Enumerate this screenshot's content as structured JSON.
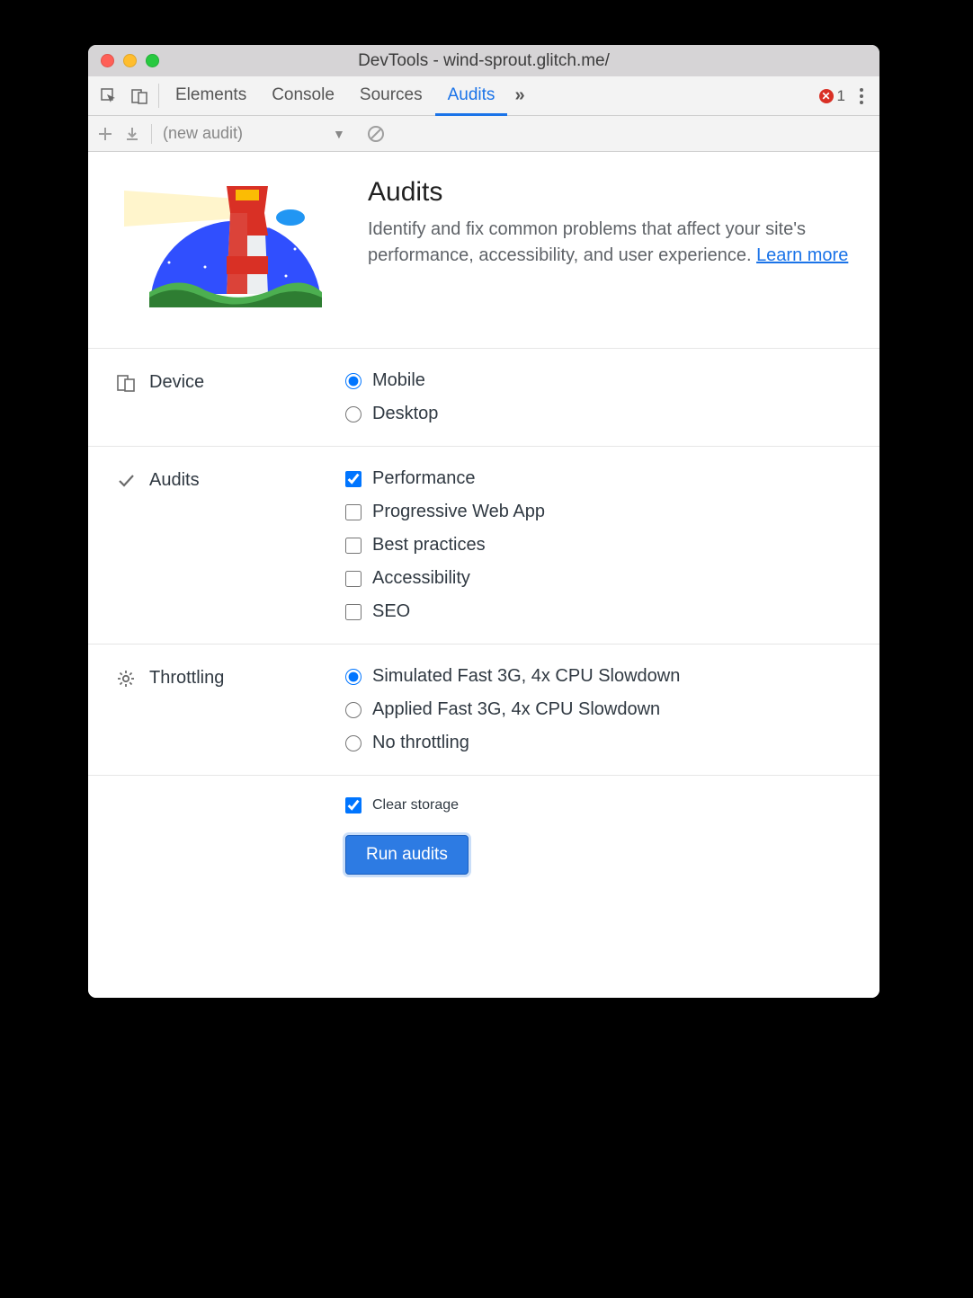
{
  "window": {
    "title": "DevTools - wind-sprout.glitch.me/"
  },
  "tabs": {
    "items": [
      "Elements",
      "Console",
      "Sources",
      "Audits"
    ],
    "active_index": 3,
    "error_count": "1"
  },
  "toolbar": {
    "select_label": "(new audit)"
  },
  "intro": {
    "heading": "Audits",
    "body_prefix": "Identify and fix common problems that affect your site's performance, accessibility, and user experience. ",
    "learn_more": "Learn more"
  },
  "sections": {
    "device": {
      "label": "Device",
      "options": [
        {
          "label": "Mobile",
          "checked": true
        },
        {
          "label": "Desktop",
          "checked": false
        }
      ]
    },
    "audits": {
      "label": "Audits",
      "options": [
        {
          "label": "Performance",
          "checked": true
        },
        {
          "label": "Progressive Web App",
          "checked": false
        },
        {
          "label": "Best practices",
          "checked": false
        },
        {
          "label": "Accessibility",
          "checked": false
        },
        {
          "label": "SEO",
          "checked": false
        }
      ]
    },
    "throttling": {
      "label": "Throttling",
      "options": [
        {
          "label": "Simulated Fast 3G, 4x CPU Slowdown",
          "checked": true
        },
        {
          "label": "Applied Fast 3G, 4x CPU Slowdown",
          "checked": false
        },
        {
          "label": "No throttling",
          "checked": false
        }
      ]
    },
    "storage": {
      "label": "Clear storage",
      "checked": true
    }
  },
  "run_button": "Run audits"
}
